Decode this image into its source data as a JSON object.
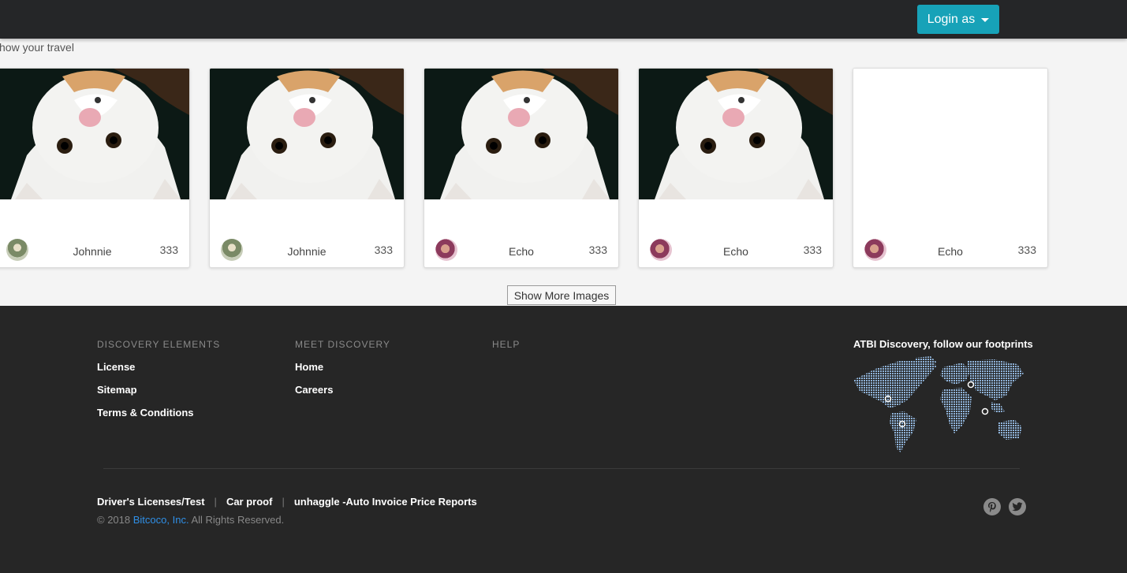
{
  "nav": {
    "login_label": "Login as"
  },
  "tagline": "how your travel",
  "cards": [
    {
      "name": "Johnnie",
      "count": "333",
      "image": "cat-photo",
      "avatar": "johnnie"
    },
    {
      "name": "Johnnie",
      "count": "333",
      "image": "cat-photo",
      "avatar": "johnnie"
    },
    {
      "name": "Echo",
      "count": "333",
      "image": "cat-photo",
      "avatar": "echo"
    },
    {
      "name": "Echo",
      "count": "333",
      "image": "cat-photo",
      "avatar": "echo"
    },
    {
      "name": "Echo",
      "count": "333",
      "image": "blank",
      "avatar": "echo"
    }
  ],
  "show_more_label": "Show More Images",
  "footer": {
    "col1": {
      "heading": "DISCOVERY ELEMENTS",
      "links": [
        "License",
        "Sitemap",
        "Terms & Conditions"
      ]
    },
    "col2": {
      "heading": "MEET DISCOVERY",
      "links": [
        "Home",
        "Careers"
      ]
    },
    "col3": {
      "heading": "HELP"
    },
    "map_title": "ATBI Discovery, follow our footprints",
    "bottom_links": [
      "Driver's Licenses/Test",
      "Car proof",
      "unhaggle -Auto Invoice Price Reports"
    ],
    "copyright_prefix": "© 2018",
    "copyright_brand": "Bitcoco, Inc.",
    "copyright_suffix": "All Rights Reserved.",
    "social_icons": [
      "pinterest-icon",
      "twitter-icon"
    ]
  },
  "colors": {
    "navbar": "#252628",
    "accent": "#17a2b8",
    "footer": "#262626",
    "brand_link": "#2f8fe6",
    "map_dots": "#8fb3d9"
  }
}
